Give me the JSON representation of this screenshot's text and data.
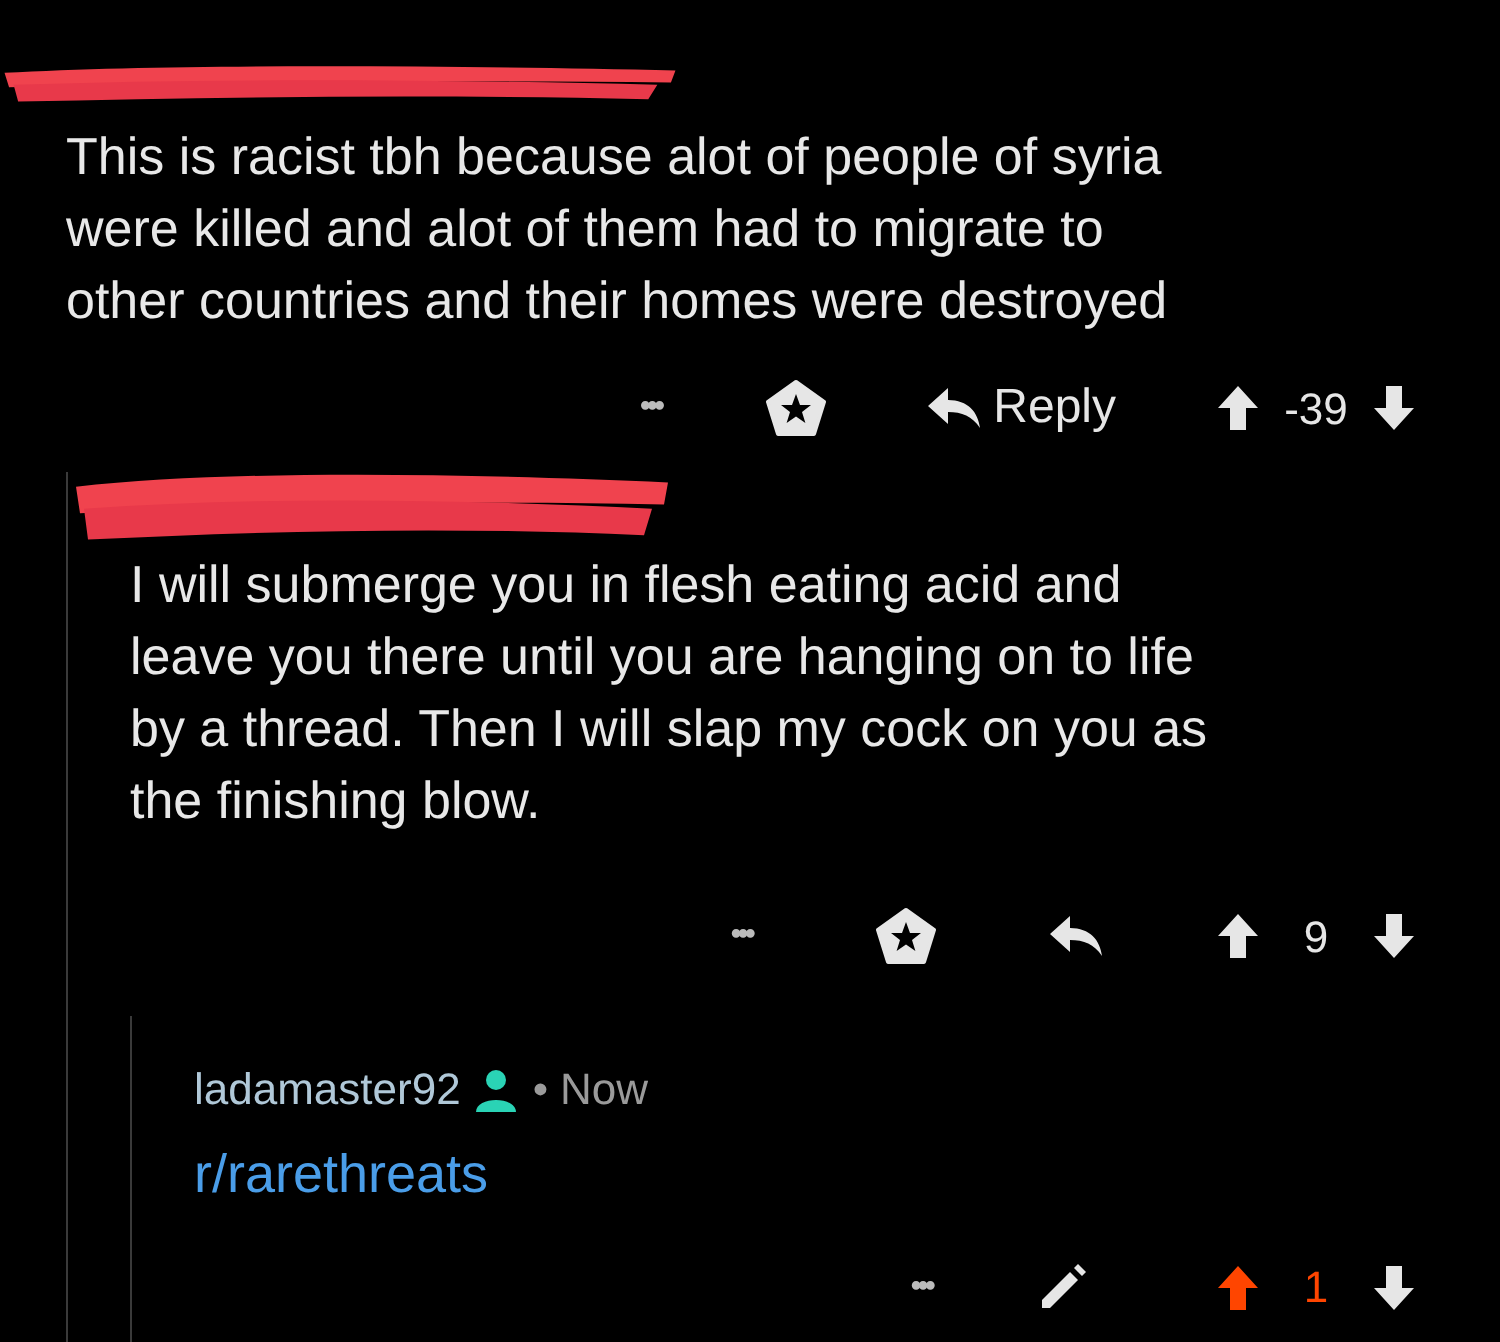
{
  "comments": [
    {
      "kind": "other",
      "body_lines": [
        "This is racist tbh because alot of people of syria",
        "were killed and alot of them had to migrate to",
        "other countries and their homes were destroyed"
      ],
      "actions": {
        "more": "•••",
        "reply_label": "Reply",
        "score": "-39",
        "upvoted": false
      }
    },
    {
      "kind": "other",
      "body_lines": [
        "I will submerge you in flesh eating acid and",
        "leave you there until you are hanging on to life",
        "by a thread. Then I will slap my cock on you as",
        "the finishing blow."
      ],
      "actions": {
        "more": "•••",
        "score": "9",
        "upvoted": false
      }
    },
    {
      "kind": "own",
      "author": "ladamaster92",
      "separator": "•",
      "time": "Now",
      "link": "r/rarethreats",
      "actions": {
        "more": "•••",
        "score": "1",
        "upvoted": true
      }
    }
  ]
}
